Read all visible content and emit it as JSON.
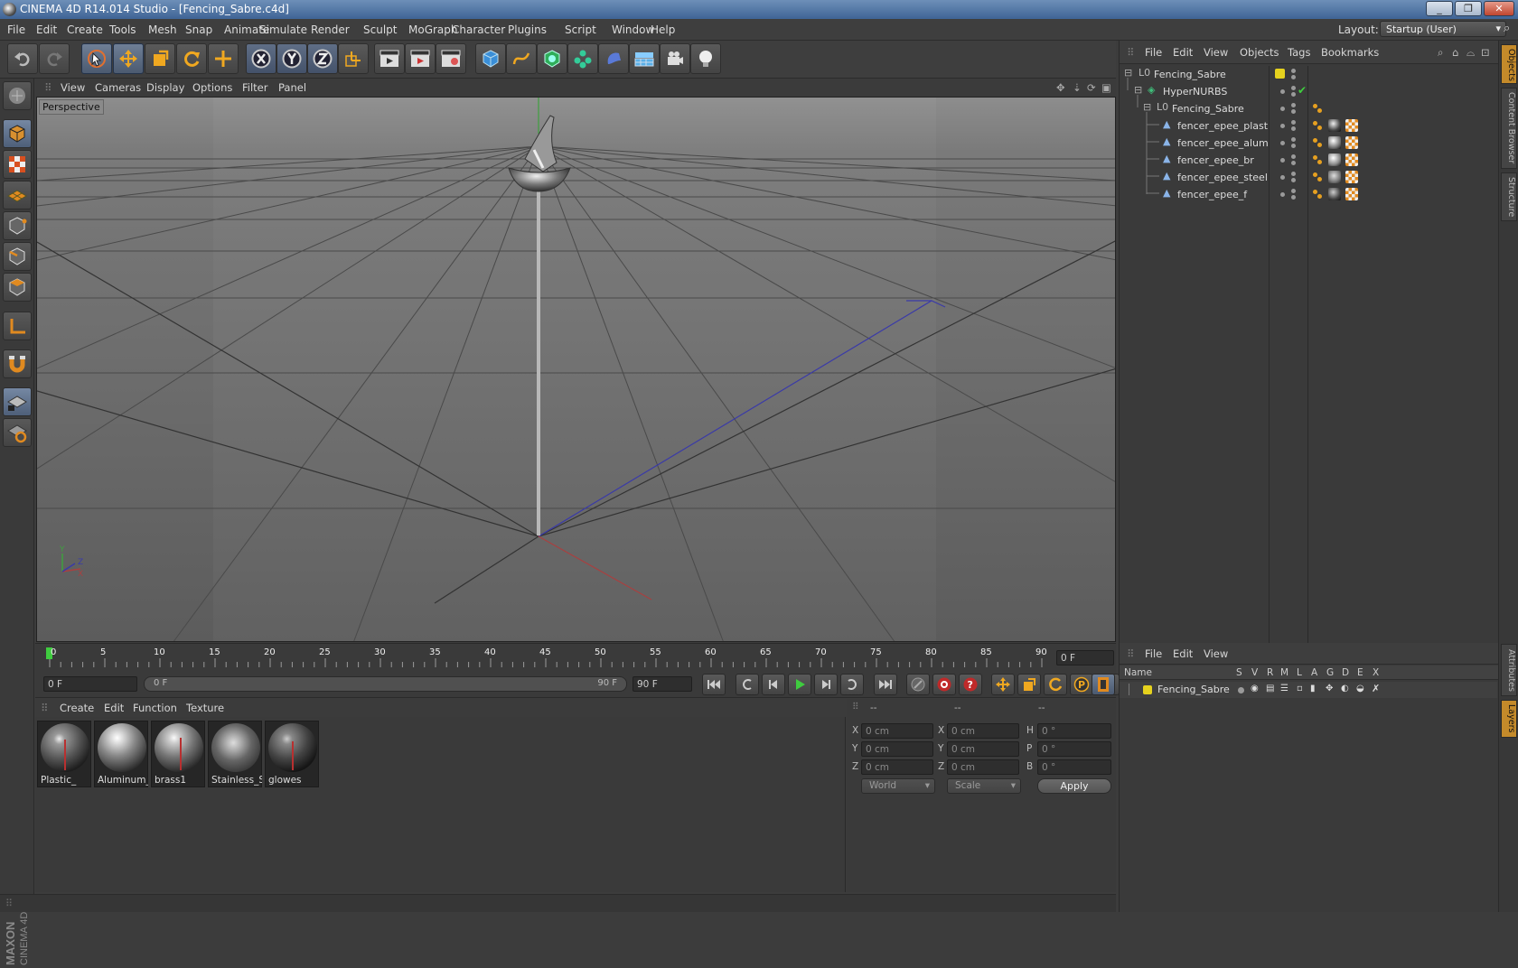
{
  "window": {
    "title": "CINEMA 4D R14.014 Studio - [Fencing_Sabre.c4d]",
    "controls": [
      "_",
      "❐",
      "✕"
    ]
  },
  "menubar": {
    "items": [
      "File",
      "Edit",
      "Create",
      "Tools",
      "Mesh",
      "Snap",
      "Animate",
      "Simulate",
      "Render",
      "Sculpt",
      "MoGraph",
      "Character",
      "Plugins",
      "Script",
      "Window",
      "Help"
    ],
    "layout_label": "Layout:",
    "layout_value": "Startup (User)"
  },
  "viewport": {
    "menu": [
      "View",
      "Cameras",
      "Display",
      "Options",
      "Filter",
      "Panel"
    ],
    "label": "Perspective",
    "axis_labels": {
      "y": "Y",
      "z": "Z",
      "x": "X"
    }
  },
  "timeline": {
    "ticks": [
      "0",
      "5",
      "10",
      "15",
      "20",
      "25",
      "30",
      "35",
      "40",
      "45",
      "50",
      "55",
      "60",
      "65",
      "70",
      "75",
      "80",
      "85",
      "90"
    ],
    "current_frame": "0 F",
    "start_field": "0 F",
    "range_start": "0 F",
    "range_end": "90 F",
    "end_field": "90 F"
  },
  "materials": {
    "menu": [
      "Create",
      "Edit",
      "Function",
      "Texture"
    ],
    "items": [
      {
        "name": "Plastic_"
      },
      {
        "name": "Aluminum_"
      },
      {
        "name": "brass1"
      },
      {
        "name": "Stainless_S"
      },
      {
        "name": "glowes"
      }
    ]
  },
  "coordinates": {
    "headers": [
      "--",
      "--",
      "--"
    ],
    "rows": [
      {
        "a": "X",
        "av": "0 cm",
        "b": "X",
        "bv": "0 cm",
        "c": "H",
        "cv": "0 °"
      },
      {
        "a": "Y",
        "av": "0 cm",
        "b": "Y",
        "bv": "0 cm",
        "c": "P",
        "cv": "0 °"
      },
      {
        "a": "Z",
        "av": "0 cm",
        "b": "Z",
        "bv": "0 cm",
        "c": "B",
        "cv": "0 °"
      }
    ],
    "mode_dropdown": "World",
    "size_dropdown": "Scale",
    "apply_label": "Apply"
  },
  "objects": {
    "menu": [
      "File",
      "Edit",
      "View",
      "Objects",
      "Tags",
      "Bookmarks"
    ],
    "tree": [
      {
        "label": "Fencing_Sabre",
        "depth": 0
      },
      {
        "label": "HyperNURBS",
        "depth": 1
      },
      {
        "label": "Fencing_Sabre",
        "depth": 2
      },
      {
        "label": "fencer_epee_plast",
        "depth": 3
      },
      {
        "label": "fencer_epee_alum",
        "depth": 3
      },
      {
        "label": "fencer_epee_br",
        "depth": 3
      },
      {
        "label": "fencer_epee_steel",
        "depth": 3
      },
      {
        "label": "fencer_epee_f",
        "depth": 3
      }
    ],
    "checkmark": "✔"
  },
  "layers": {
    "menu": [
      "File",
      "Edit",
      "View"
    ],
    "columns": [
      "Name",
      "S",
      "V",
      "R",
      "M",
      "L",
      "A",
      "G",
      "D",
      "E",
      "X"
    ],
    "rows": [
      {
        "name": "Fencing_Sabre"
      }
    ]
  },
  "side_tabs": [
    "Objects",
    "Content Browser",
    "Structure",
    "Attributes",
    "Layers"
  ],
  "brand": {
    "maxon": "MAXON",
    "product": "CINEMA 4D"
  },
  "colors": {
    "accent_orange": "#e6a020",
    "axis_blue": "#3a3aa8",
    "axis_red": "#a84040",
    "axis_green": "#3fa03f",
    "layer_yellow": "#e6d21e"
  }
}
